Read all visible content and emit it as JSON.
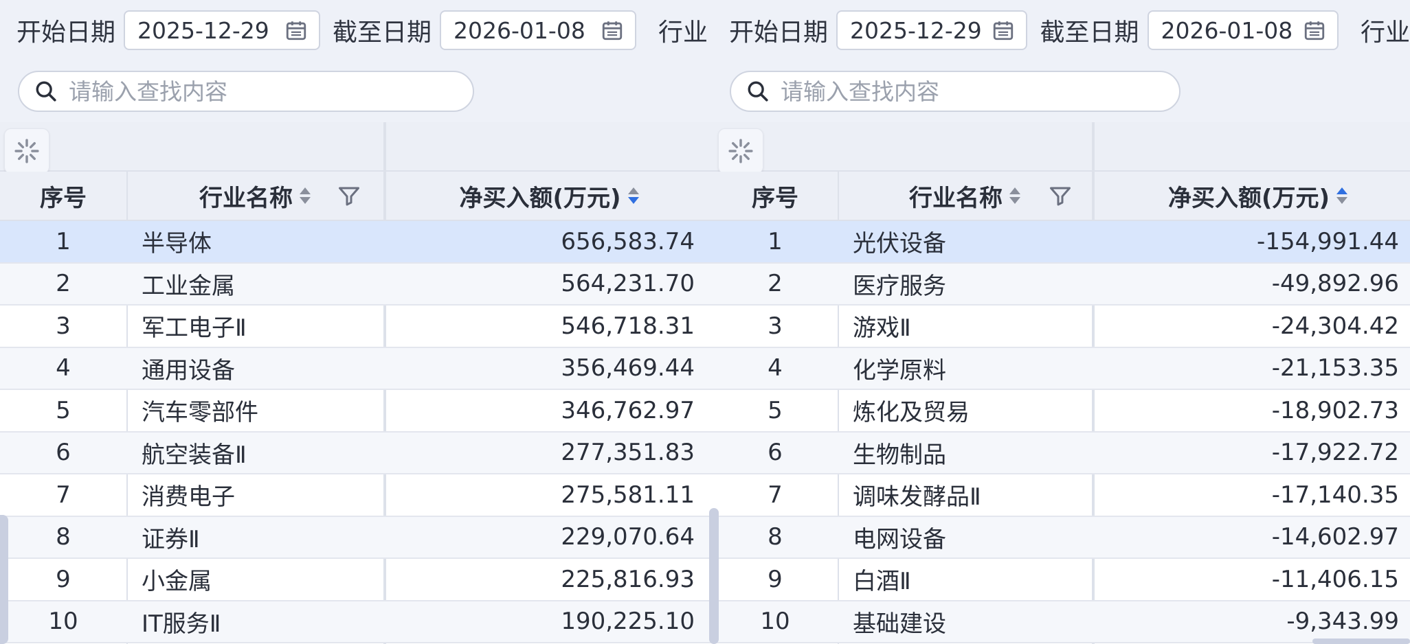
{
  "left": {
    "filters": {
      "start_label": "开始日期",
      "start_value": "2025-12-29",
      "end_label": "截至日期",
      "end_value": "2026-01-08",
      "industry_label": "行业"
    },
    "search": {
      "placeholder": "请输入查找内容"
    },
    "headers": {
      "index": "序号",
      "name": "行业名称",
      "value": "净买入额(万元)"
    },
    "sort_state": "descending",
    "rows": [
      {
        "index": "1",
        "name": "半导体",
        "value": "656,583.74"
      },
      {
        "index": "2",
        "name": "工业金属",
        "value": "564,231.70"
      },
      {
        "index": "3",
        "name": "军工电子Ⅱ",
        "value": "546,718.31"
      },
      {
        "index": "4",
        "name": "通用设备",
        "value": "356,469.44"
      },
      {
        "index": "5",
        "name": "汽车零部件",
        "value": "346,762.97"
      },
      {
        "index": "6",
        "name": "航空装备Ⅱ",
        "value": "277,351.83"
      },
      {
        "index": "7",
        "name": "消费电子",
        "value": "275,581.11"
      },
      {
        "index": "8",
        "name": "证券Ⅱ",
        "value": "229,070.64"
      },
      {
        "index": "9",
        "name": "小金属",
        "value": "225,816.93"
      },
      {
        "index": "10",
        "name": "IT服务Ⅱ",
        "value": "190,225.10"
      }
    ]
  },
  "right": {
    "filters": {
      "start_label": "开始日期",
      "start_value": "2025-12-29",
      "end_label": "截至日期",
      "end_value": "2026-01-08",
      "industry_label": "行业"
    },
    "search": {
      "placeholder": "请输入查找内容"
    },
    "headers": {
      "index": "序号",
      "name": "行业名称",
      "value": "净买入额(万元)"
    },
    "sort_state": "ascending",
    "rows": [
      {
        "index": "1",
        "name": "光伏设备",
        "value": "-154,991.44"
      },
      {
        "index": "2",
        "name": "医疗服务",
        "value": "-49,892.96"
      },
      {
        "index": "3",
        "name": "游戏Ⅱ",
        "value": "-24,304.42"
      },
      {
        "index": "4",
        "name": "化学原料",
        "value": "-21,153.35"
      },
      {
        "index": "5",
        "name": "炼化及贸易",
        "value": "-18,902.73"
      },
      {
        "index": "6",
        "name": "生物制品",
        "value": "-17,922.72"
      },
      {
        "index": "7",
        "name": "调味发酵品Ⅱ",
        "value": "-17,140.35"
      },
      {
        "index": "8",
        "name": "电网设备",
        "value": "-14,602.97"
      },
      {
        "index": "9",
        "name": "白酒Ⅱ",
        "value": "-11,406.15"
      },
      {
        "index": "10",
        "name": "基础建设",
        "value": "-9,343.99"
      }
    ]
  },
  "colors": {
    "selected_row": "#d9e6fc",
    "sort_active": "#2f6fe0",
    "header_bg": "#eceff6"
  }
}
